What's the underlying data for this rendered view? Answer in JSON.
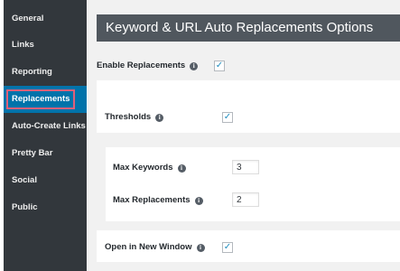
{
  "sidebar": {
    "items": [
      {
        "label": "General"
      },
      {
        "label": "Links"
      },
      {
        "label": "Reporting"
      },
      {
        "label": "Replacements"
      },
      {
        "label": "Auto-Create Links"
      },
      {
        "label": "Pretty Bar"
      },
      {
        "label": "Social"
      },
      {
        "label": "Public"
      }
    ],
    "active_index": 3
  },
  "header": {
    "title": "Keyword & URL Auto Replacements Options"
  },
  "options": {
    "enable_replacements": {
      "label": "Enable Replacements",
      "checked": true,
      "check_glyph": "✓"
    },
    "thresholds": {
      "label": "Thresholds",
      "checked": true,
      "check_glyph": "✓"
    },
    "max_keywords": {
      "label": "Max Keywords",
      "value": "3"
    },
    "max_replacements": {
      "label": "Max Replacements",
      "value": "2"
    },
    "open_new_window": {
      "label": "Open in New Window",
      "checked": true,
      "check_glyph": "✓"
    }
  },
  "icons": {
    "info": "i"
  }
}
